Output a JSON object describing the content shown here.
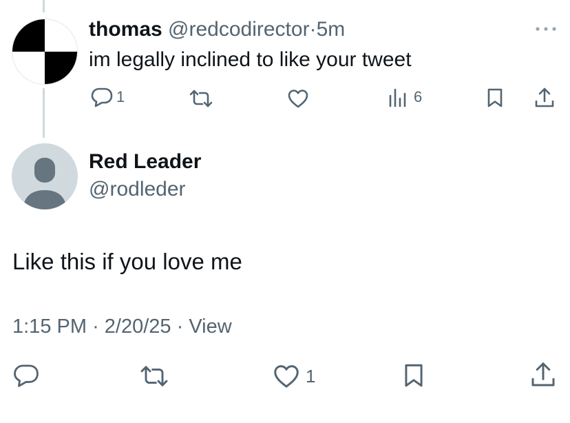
{
  "reply": {
    "name": "thomas",
    "handle": "@redcodirector",
    "separator": "·",
    "time": "5m",
    "text": "im legally inclined to like your tweet",
    "counts": {
      "replies": "1",
      "views": "6"
    }
  },
  "main_tweet": {
    "name": "Red Leader",
    "handle": "@rodleder",
    "text": "Like this if you love me",
    "time": "1:15 PM",
    "separator": "·",
    "date": "2/20/25",
    "view_label": "View",
    "counts": {
      "likes": "1"
    }
  },
  "icons": {
    "reply": "reply-bubble-icon",
    "retweet": "retweet-icon",
    "like": "heart-icon",
    "views": "views-chart-icon",
    "bookmark": "bookmark-icon",
    "share": "share-icon",
    "more": "more-dots-icon"
  },
  "colors": {
    "text_primary": "#0f1419",
    "text_secondary": "#536471",
    "thread_line": "#cfd9de",
    "default_avatar_bg": "#cfd9de",
    "default_avatar_fg": "#66757f"
  }
}
